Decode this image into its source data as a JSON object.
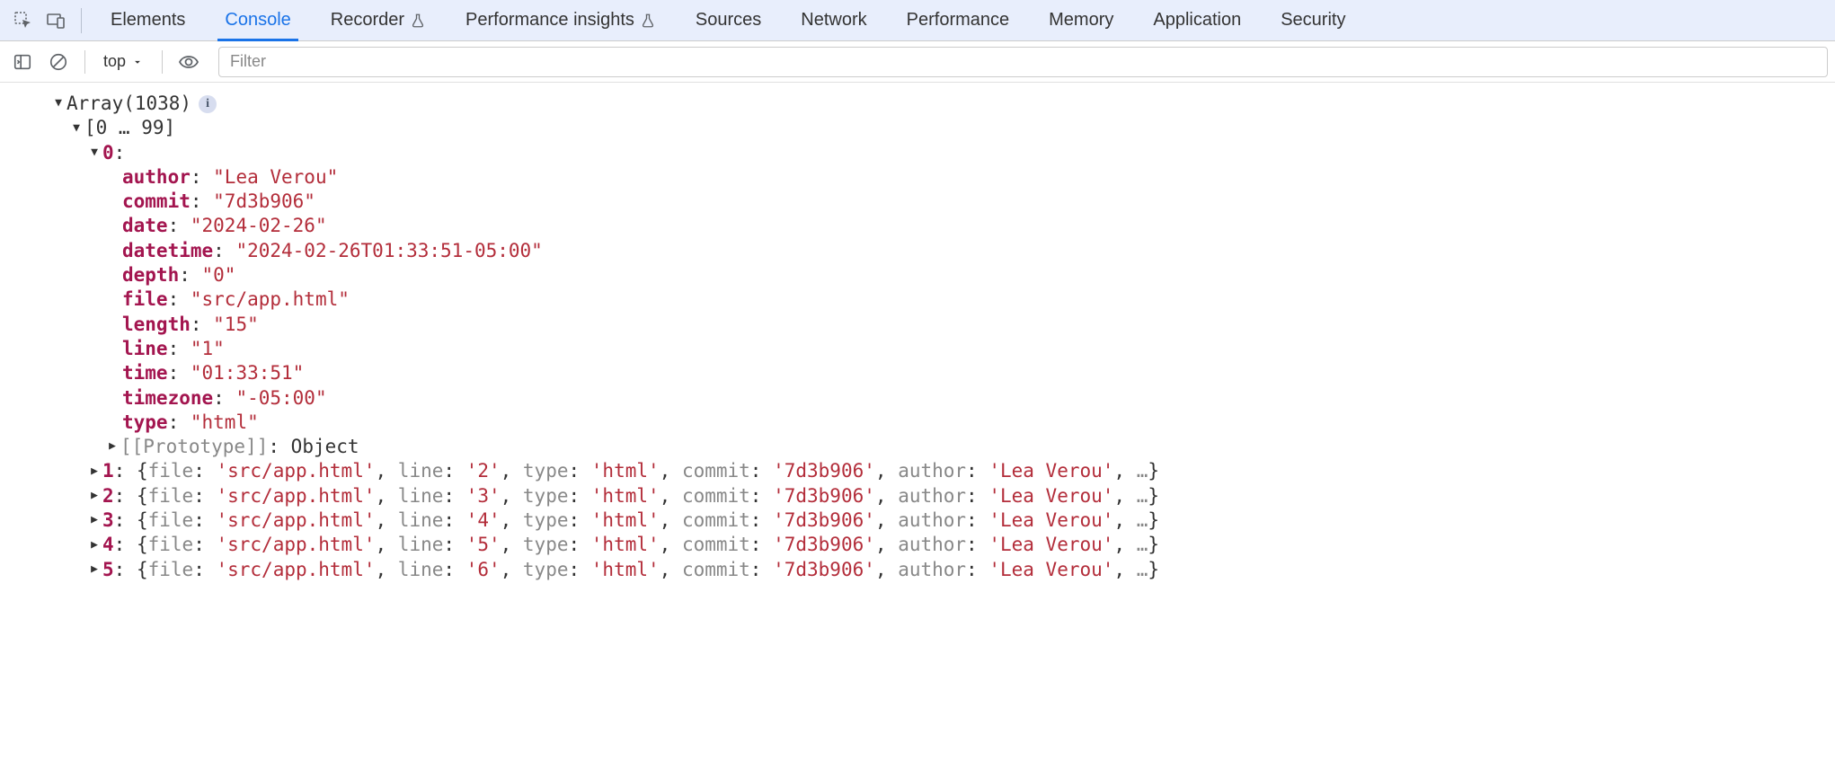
{
  "tabs": {
    "elements": "Elements",
    "console": "Console",
    "recorder": "Recorder",
    "perf_insights": "Performance insights",
    "sources": "Sources",
    "network": "Network",
    "performance": "Performance",
    "memory": "Memory",
    "application": "Application",
    "security": "Security"
  },
  "toolbar": {
    "context": "top",
    "filter_placeholder": "Filter"
  },
  "console": {
    "array_label": "Array(1038)",
    "range_label": "[0 … 99]",
    "index0": "0",
    "obj0": {
      "author_key": "author",
      "author_val": "\"Lea Verou\"",
      "commit_key": "commit",
      "commit_val": "\"7d3b906\"",
      "date_key": "date",
      "date_val": "\"2024-02-26\"",
      "datetime_key": "datetime",
      "datetime_val": "\"2024-02-26T01:33:51-05:00\"",
      "depth_key": "depth",
      "depth_val": "\"0\"",
      "file_key": "file",
      "file_val": "\"src/app.html\"",
      "length_key": "length",
      "length_val": "\"15\"",
      "line_key": "line",
      "line_val": "\"1\"",
      "time_key": "time",
      "time_val": "\"01:33:51\"",
      "timezone_key": "timezone",
      "timezone_val": "\"-05:00\"",
      "type_key": "type",
      "type_val": "\"html\""
    },
    "proto_label": "[[Prototype]]",
    "proto_val": "Object",
    "rows": [
      {
        "idx": "1",
        "line": "'2'"
      },
      {
        "idx": "2",
        "line": "'3'"
      },
      {
        "idx": "3",
        "line": "'4'"
      },
      {
        "idx": "4",
        "line": "'5'"
      },
      {
        "idx": "5",
        "line": "'6'"
      }
    ],
    "summary_tpl": {
      "file_k": "file",
      "file_v": "'src/app.html'",
      "line_k": "line",
      "type_k": "type",
      "type_v": "'html'",
      "commit_k": "commit",
      "commit_v": "'7d3b906'",
      "author_k": "author",
      "author_v": "'Lea Verou'",
      "ellipsis": "…"
    }
  }
}
